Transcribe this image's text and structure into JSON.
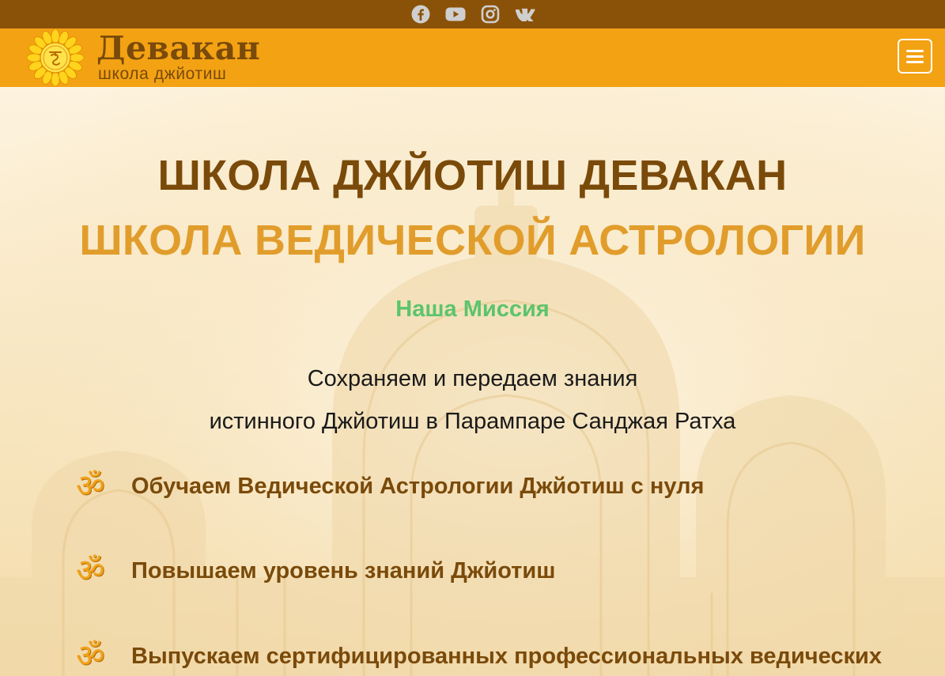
{
  "social": [
    {
      "name": "facebook-icon",
      "color": "#cfcfcf"
    },
    {
      "name": "youtube-icon",
      "color": "#cfcfcf"
    },
    {
      "name": "instagram-icon",
      "color": "#cfcfcf"
    },
    {
      "name": "vk-icon",
      "color": "#cfcfcf"
    }
  ],
  "header": {
    "brand_name": "Девакан",
    "brand_sub": "школа джйотиш",
    "logo_icon": "sunflower-logo-icon",
    "menu_icon": "hamburger-menu-icon"
  },
  "hero": {
    "title": "ШКОЛА ДЖЙОТИШ ДЕВАКАН",
    "subtitle": "ШКОЛА ВЕДИЧЕСКОЙ АСТРОЛОГИИ",
    "mission": "Наша Миссия",
    "lead_line1": "Сохраняем и передаем знания",
    "lead_line2": "истинного Джйотиш в Парампаре Санджая Ратха",
    "bullet_glyph": "ॐ",
    "items": [
      "Обучаем Ведической Астрологии Джйотиш с нуля",
      "Повышаем уровень знаний Джйотиш",
      "Выпускаем сертифицированных профессиональных ведических"
    ]
  },
  "colors": {
    "topbar": "#8a5208",
    "header": "#f3a213",
    "brown": "#7a4a0a",
    "gold": "#e19d2c",
    "green": "#5cc46d"
  }
}
